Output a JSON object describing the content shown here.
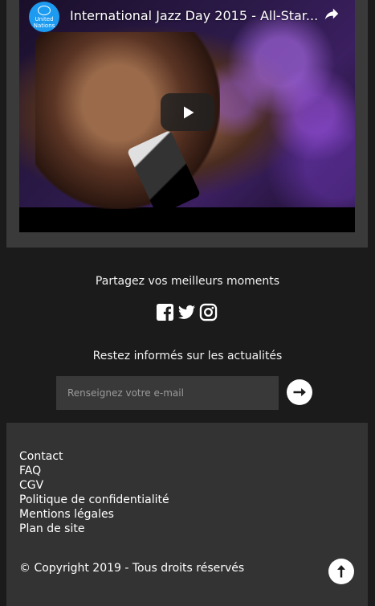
{
  "video": {
    "title": "International Jazz Day 2015 - All-Star...",
    "channel_logo_text": "United Nations",
    "play_icon": "play-icon",
    "share_icon": "share-arrow-icon"
  },
  "social": {
    "heading": "Partagez vos meilleurs moments",
    "icons": [
      "facebook-icon",
      "twitter-icon",
      "instagram-icon"
    ]
  },
  "newsletter": {
    "heading": "Restez informés sur les actualités",
    "email_placeholder": "Renseignez votre e-mail",
    "email_value": "",
    "submit_icon": "arrow-right-icon"
  },
  "footer": {
    "links": [
      "Contact",
      "FAQ",
      "CGV",
      "Politique de confidentialité",
      "Mentions légales",
      "Plan de site"
    ],
    "copyright": "© Copyright 2019 - Tous droits réservés",
    "back_to_top_icon": "arrow-up-icon"
  },
  "colors": {
    "page_background": "#1b1b1b",
    "panel_background": "#333333",
    "input_background": "#393939",
    "channel_logo": "#1d9bf0"
  }
}
